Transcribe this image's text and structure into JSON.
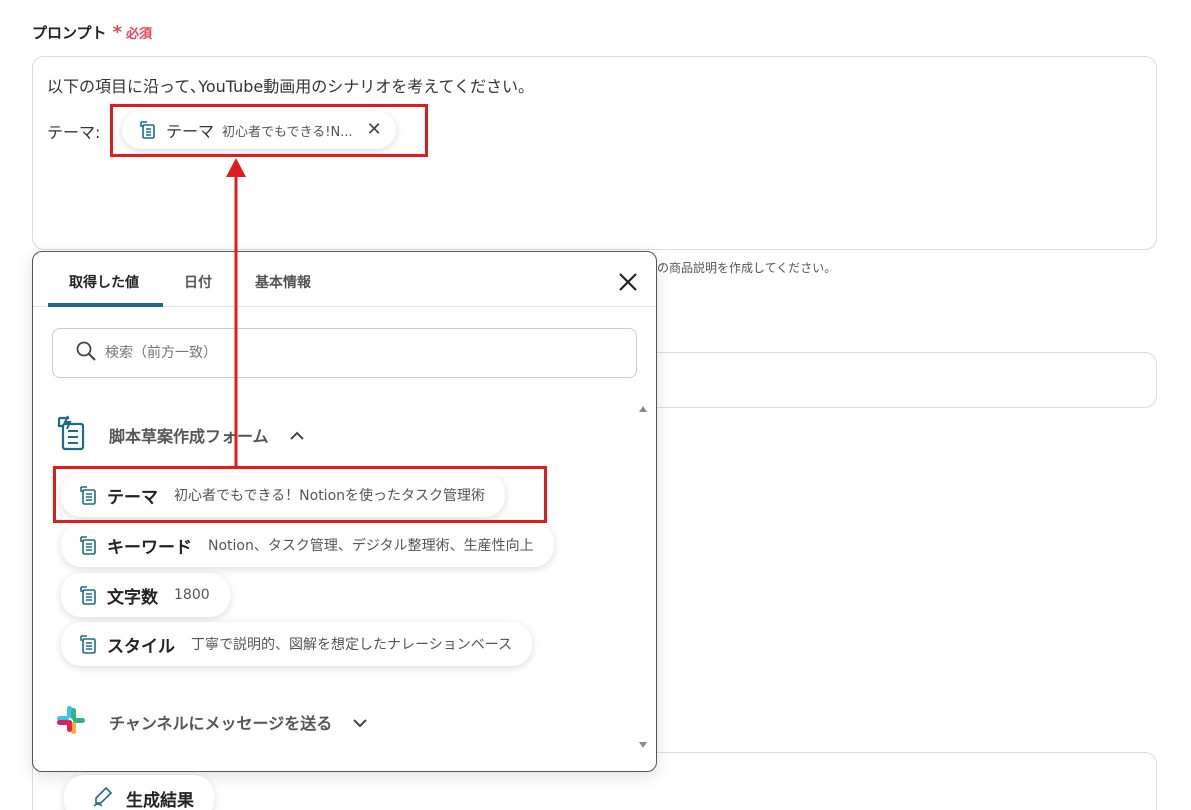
{
  "field": {
    "label": "プロンプト",
    "asterisk": "*",
    "required": "必須"
  },
  "prompt": {
    "line1": "以下の項目に沿って､YouTube動画用のシナリオを考えてください。",
    "theme_label": "テーマ:",
    "inline_chip": {
      "name": "テーマ",
      "value": "初心者でもできる!N...",
      "close": "✕",
      "icon": "form-doc-icon"
    }
  },
  "background": {
    "hint": "の商品説明を作成してください。"
  },
  "popup": {
    "tabs": [
      "取得した値",
      "日付",
      "基本情報"
    ],
    "active_tab": "取得した値",
    "close": "close-icon",
    "search_placeholder": "検索（前方一致）",
    "groups": [
      {
        "title": "脚本草案作成フォーム",
        "icon": "form-doc-icon",
        "expanded": true,
        "items": [
          {
            "name": "テーマ",
            "value": "初心者でもできる！Notionを使ったタスク管理術"
          },
          {
            "name": "キーワード",
            "value": "Notion、タスク管理、デジタル整理術、生産性向上"
          },
          {
            "name": "文字数",
            "value": "1800"
          },
          {
            "name": "スタイル",
            "value": "丁寧で説明的、図解を想定したナレーションベース"
          }
        ]
      },
      {
        "title": "チャンネルにメッセージを送る",
        "icon": "slack-icon",
        "expanded": false
      }
    ]
  },
  "result_chip": {
    "name": "生成結果",
    "icon": "pen-icon"
  },
  "colors": {
    "accent": "#1b6c84",
    "highlight": "#e01d1d",
    "required": "#e5455b"
  }
}
